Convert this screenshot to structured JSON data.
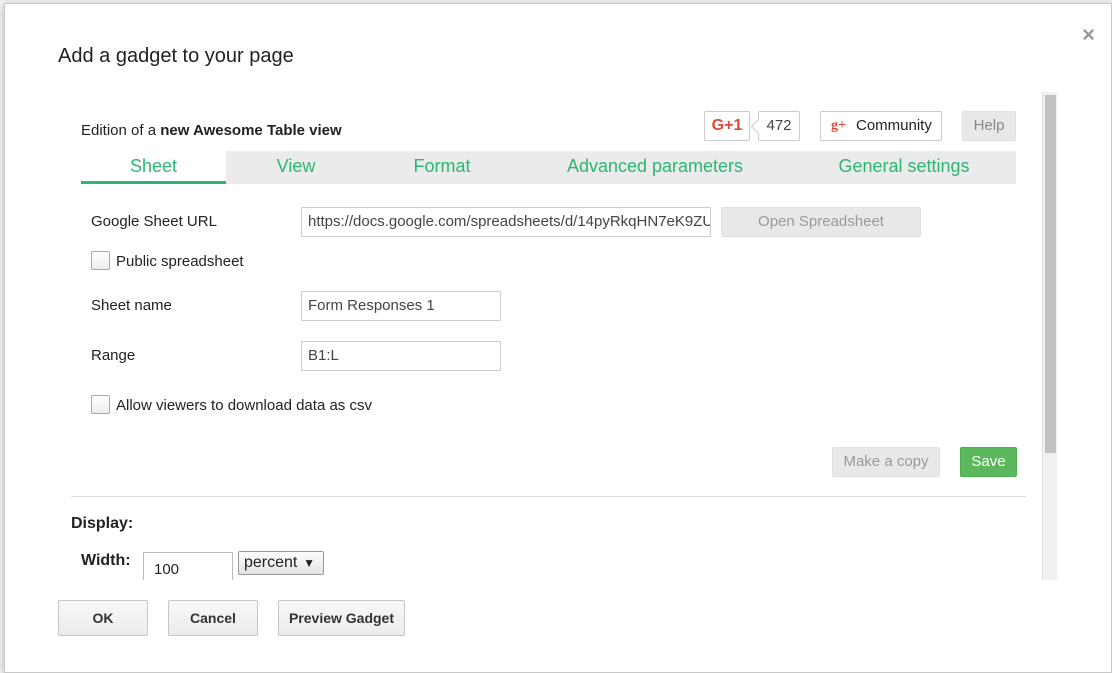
{
  "dialog": {
    "title": "Add a gadget to your page",
    "close_glyph": "×"
  },
  "header": {
    "edition_prefix": "Edition of a",
    "edition_bold": "new Awesome Table view",
    "gplus_label": "G+1",
    "gplus_count": "472",
    "community_icon": "g+",
    "community_label": "Community",
    "help_label": "Help"
  },
  "tabs": [
    {
      "label": "Sheet",
      "active": true
    },
    {
      "label": "View",
      "active": false
    },
    {
      "label": "Format",
      "active": false
    },
    {
      "label": "Advanced parameters",
      "active": false
    },
    {
      "label": "General settings",
      "active": false
    }
  ],
  "sheet_form": {
    "url_label": "Google Sheet URL",
    "url_value": "https://docs.google.com/spreadsheets/d/14pyRkqHN7eK9ZU",
    "open_button": "Open Spreadsheet",
    "public_label": "Public spreadsheet",
    "public_checked": false,
    "sheet_name_label": "Sheet name",
    "sheet_name_value": "Form Responses 1",
    "range_label": "Range",
    "range_value": "B1:L",
    "csv_label": "Allow viewers to download data as csv",
    "csv_checked": false,
    "copy_button": "Make a copy",
    "save_button": "Save"
  },
  "display": {
    "section_label": "Display:",
    "width_label": "Width:",
    "width_value": "100",
    "unit_value": "percent",
    "unit_arrow": "▼"
  },
  "footer": {
    "ok_label": "OK",
    "cancel_label": "Cancel",
    "preview_label": "Preview Gadget"
  },
  "colors": {
    "accent": "#2bb673",
    "save": "#5cb85c",
    "gplus": "#dd4b39"
  }
}
